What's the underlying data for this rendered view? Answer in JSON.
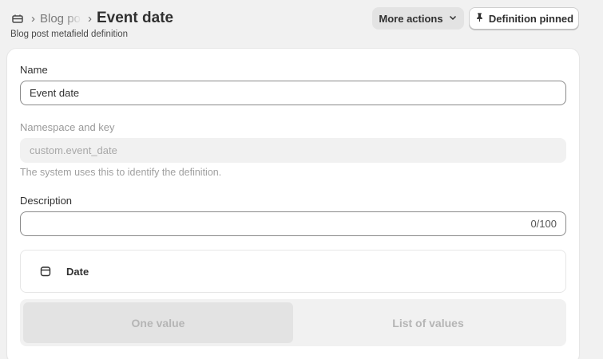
{
  "breadcrumb": {
    "icon": "blog-post-icon",
    "parent_label": "Blog posts",
    "current_title": "Event date"
  },
  "subtitle": "Blog post metafield definition",
  "actions": {
    "more_actions_label": "More actions",
    "pinned_label": "Definition pinned"
  },
  "form": {
    "name_label": "Name",
    "name_value": "Event date",
    "namespace_label": "Namespace and key",
    "namespace_value": "custom.event_date",
    "namespace_help": "The system uses this to identify the definition.",
    "description_label": "Description",
    "description_value": "",
    "description_counter": "0/100"
  },
  "type": {
    "icon": "calendar-icon",
    "label": "Date"
  },
  "value_mode": {
    "options": [
      "One value",
      "List of values"
    ],
    "selected": "One value"
  }
}
